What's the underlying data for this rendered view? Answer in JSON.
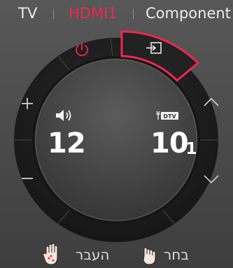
{
  "inputs": [
    {
      "label": "TV",
      "active": false
    },
    {
      "label": "HDMI1",
      "active": true
    },
    {
      "label": "Component",
      "active": false
    }
  ],
  "remote": {
    "power_icon": "power-icon",
    "input_icon": "input-source-icon",
    "volume_up_icon": "plus-icon",
    "volume_down_icon": "minus-icon",
    "channel_up_icon": "chevron-up-icon",
    "channel_down_icon": "chevron-down-icon",
    "highlighted_button": "input-source"
  },
  "volume": {
    "icon": "speaker-icon",
    "value": "12"
  },
  "channel": {
    "badge": "DTV",
    "main": "10",
    "sub": "-1"
  },
  "hints": {
    "move_label": "העבר",
    "move_icon": "open-hand-icon",
    "select_label": "בחר",
    "select_icon": "pointing-hand-icon"
  },
  "colors": {
    "accent": "#f0264e",
    "text": "#ececec"
  }
}
